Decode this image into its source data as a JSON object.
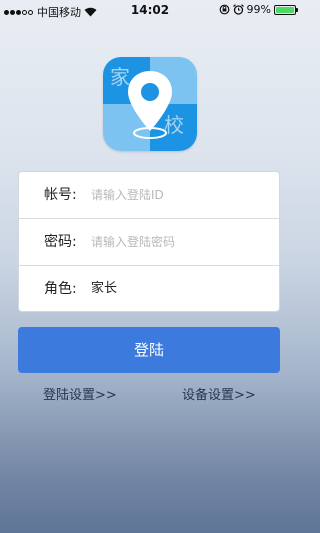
{
  "status_bar": {
    "carrier": "中国移动",
    "time": "14:02",
    "battery_percent": "99%",
    "battery_level": 0.99,
    "signal_bars_filled": 3,
    "signal_bars_total": 5
  },
  "logo": {
    "char_top": "家",
    "char_bottom": "校",
    "icon": "map-pin-icon",
    "colors": {
      "dark": "#1c93e3",
      "light": "#7cc3f2"
    }
  },
  "form": {
    "account": {
      "label": "帐号:",
      "placeholder": "请输入登陆ID"
    },
    "password": {
      "label": "密码:",
      "placeholder": "请输入登陆密码"
    },
    "role": {
      "label": "角色:",
      "value": "家长"
    }
  },
  "login_button": {
    "label": "登陆",
    "color": "#3c7bdd"
  },
  "links": {
    "login_settings": "登陆设置>>",
    "device_settings": "设备设置>>"
  }
}
